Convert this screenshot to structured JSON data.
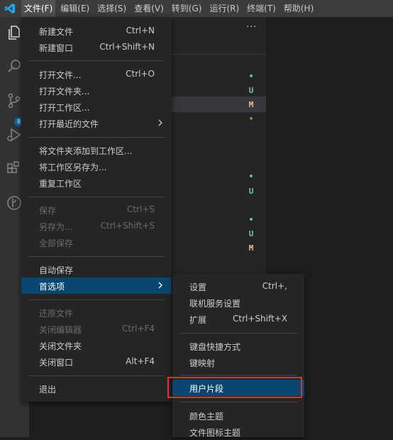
{
  "menubar": {
    "items": [
      "文件(F)",
      "编辑(E)",
      "选择(S)",
      "查看(V)",
      "转到(G)",
      "运行(R)",
      "终端(T)",
      "帮助(H)"
    ]
  },
  "activity_bar": {
    "icons": [
      "explorer-icon",
      "search-icon",
      "source-control-icon",
      "run-debug-icon",
      "extensions-icon",
      "git-graph-icon"
    ],
    "source_control_badge": "8"
  },
  "sidebar": {
    "more_actions": "···",
    "decorations": [
      "•",
      "U",
      "M",
      "•",
      "•",
      "U",
      "•",
      "U",
      "M"
    ]
  },
  "file_menu": {
    "items": [
      {
        "label": "新建文件",
        "shortcut": "Ctrl+N"
      },
      {
        "label": "新建窗口",
        "shortcut": "Ctrl+Shift+N"
      },
      {
        "label": "打开文件...",
        "shortcut": "Ctrl+O"
      },
      {
        "label": "打开文件夹...",
        "shortcut": ""
      },
      {
        "label": "打开工作区...",
        "shortcut": ""
      },
      {
        "label": "打开最近的文件",
        "shortcut": ""
      },
      {
        "label": "将文件夹添加到工作区...",
        "shortcut": ""
      },
      {
        "label": "将工作区另存为...",
        "shortcut": ""
      },
      {
        "label": "重复工作区",
        "shortcut": ""
      },
      {
        "label": "保存",
        "shortcut": "Ctrl+S"
      },
      {
        "label": "另存为...",
        "shortcut": "Ctrl+Shift+S"
      },
      {
        "label": "全部保存",
        "shortcut": ""
      },
      {
        "label": "自动保存",
        "shortcut": ""
      },
      {
        "label": "首选项",
        "shortcut": ""
      },
      {
        "label": "还原文件",
        "shortcut": ""
      },
      {
        "label": "关闭编辑器",
        "shortcut": "Ctrl+F4"
      },
      {
        "label": "关闭文件夹",
        "shortcut": ""
      },
      {
        "label": "关闭窗口",
        "shortcut": "Alt+F4"
      },
      {
        "label": "退出",
        "shortcut": ""
      }
    ]
  },
  "preferences_menu": {
    "items": [
      {
        "label": "设置",
        "shortcut": "Ctrl+,"
      },
      {
        "label": "联机服务设置",
        "shortcut": ""
      },
      {
        "label": "扩展",
        "shortcut": "Ctrl+Shift+X"
      },
      {
        "label": "键盘快捷方式",
        "shortcut": ""
      },
      {
        "label": "键映射",
        "shortcut": ""
      },
      {
        "label": "用户片段",
        "shortcut": ""
      },
      {
        "label": "颜色主题",
        "shortcut": ""
      },
      {
        "label": "文件图标主题",
        "shortcut": ""
      }
    ]
  },
  "colors": {
    "highlight": "#094771",
    "annotation_box": "#e0302f",
    "accent_logo": "#23a9f2",
    "untracked": "#73c991",
    "modified": "#e2c08d"
  }
}
